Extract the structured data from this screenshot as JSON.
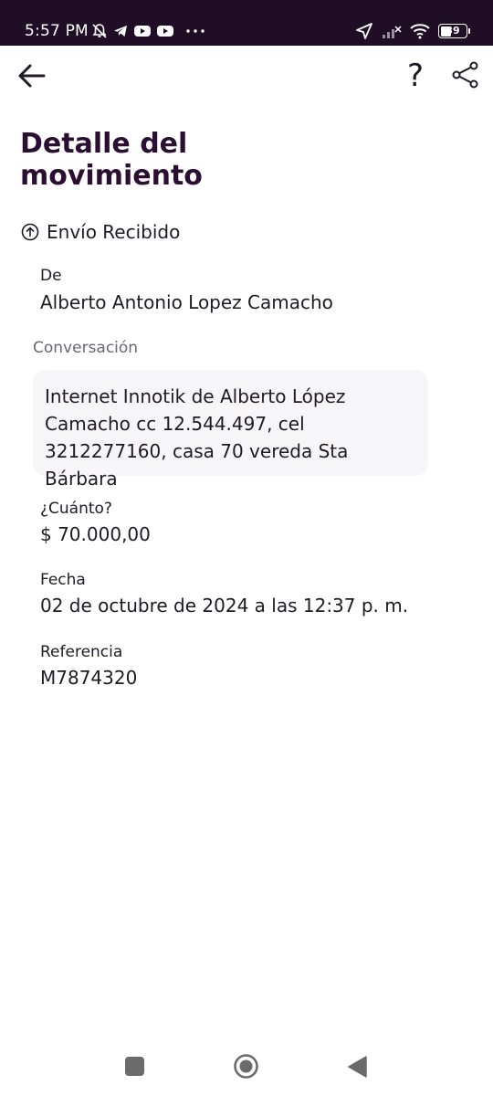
{
  "status_bar": {
    "time": "5:57 PM",
    "battery_level": "39",
    "icons": [
      "mute-icon",
      "telegram-icon",
      "youtube-icon",
      "youtube-icon",
      "more-dots-icon",
      "location-icon",
      "signal-icon",
      "wifi-icon",
      "battery-icon"
    ]
  },
  "header": {
    "help_label": "?",
    "icons": [
      "arrow-left-icon",
      "help-icon",
      "share-icon"
    ]
  },
  "page": {
    "title": "Detalle del movimiento",
    "type_icon": "arrow-up-circle-icon",
    "type": "Envío Recibido"
  },
  "details": {
    "from_label": "De",
    "from_value": "Alberto Antonio Lopez Camacho",
    "conversation_label": "Conversación",
    "conversation_text": "Internet Innotik de Alberto López Camacho cc 12.544.497, cel 3212277160, casa 70 vereda Sta Bárbara",
    "amount_label": "¿Cuánto?",
    "amount_value": "$ 70.000,00",
    "date_label": "Fecha",
    "date_value": "02 de octubre de 2024 a las 12:37 p. m.",
    "reference_label": "Referencia",
    "reference_value": "M7874320"
  },
  "nav_bar": {
    "icons": [
      "recents-square-icon",
      "home-circle-icon",
      "back-triangle-icon"
    ]
  },
  "colors": {
    "status_bar_bg": "#200d26",
    "title": "#2a0f33",
    "text": "#1f1a24",
    "muted": "#6b6670",
    "conversation_bg": "#f6f5f7"
  }
}
